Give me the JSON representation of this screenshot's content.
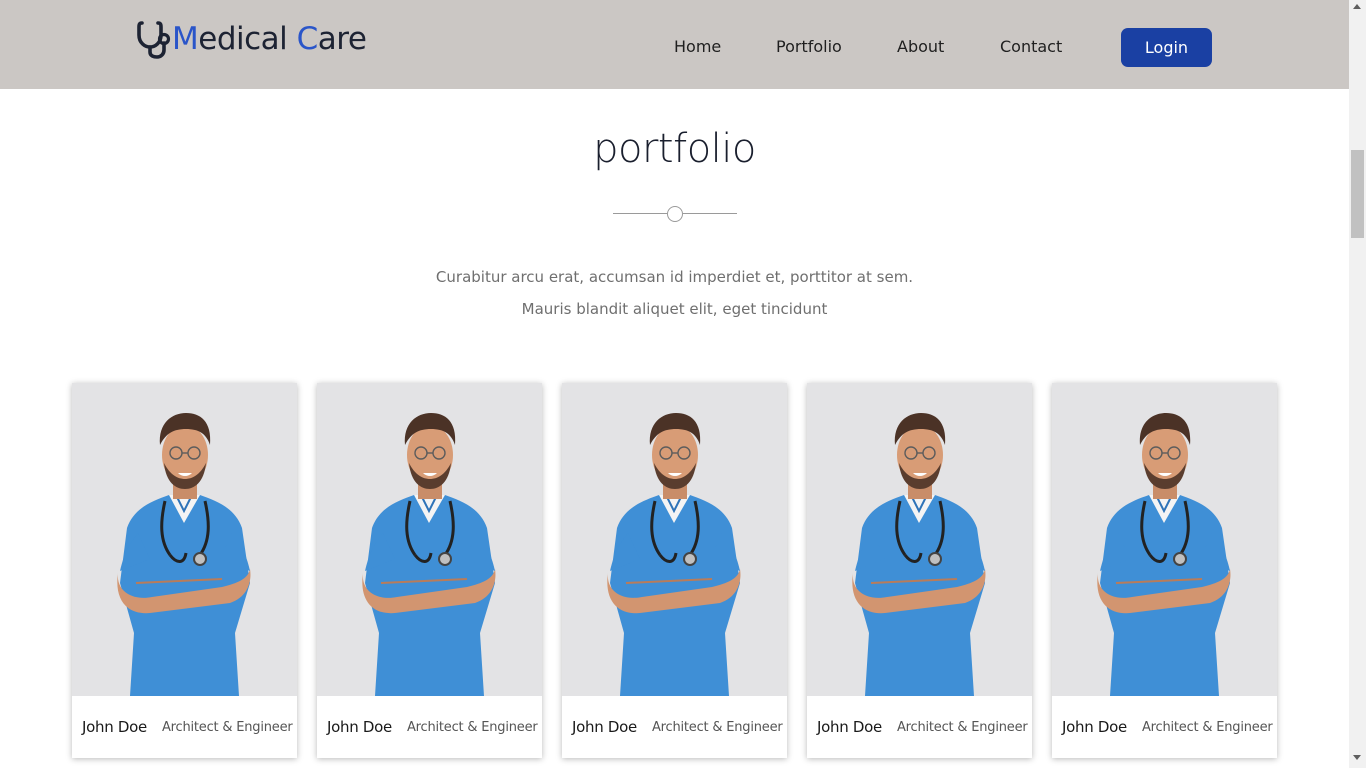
{
  "header": {
    "logo": {
      "icon": "stethoscope-icon",
      "word1_initial": "M",
      "word1_rest": "edical",
      "word2_initial": "C",
      "word2_rest": "are"
    },
    "nav": [
      "Home",
      "Portfolio",
      "About",
      "Contact"
    ],
    "login_label": "Login"
  },
  "section": {
    "title": "portfolio",
    "desc_line1": "Curabitur arcu erat, accumsan id imperdiet et, porttitor at sem.",
    "desc_line2": "Mauris blandit aliquet elit, eget tincidunt"
  },
  "cards": [
    {
      "name": "John Doe",
      "role": "Architect & Engineer",
      "image": "doctor-photo"
    },
    {
      "name": "John Doe",
      "role": "Architect & Engineer",
      "image": "doctor-photo"
    },
    {
      "name": "John Doe",
      "role": "Architect & Engineer",
      "image": "doctor-photo"
    },
    {
      "name": "John Doe",
      "role": "Architect & Engineer",
      "image": "doctor-photo"
    },
    {
      "name": "John Doe",
      "role": "Architect & Engineer",
      "image": "doctor-photo"
    }
  ],
  "colors": {
    "header_bg": "#cbc7c4",
    "brand_blue": "#2a55c9",
    "login_bg": "#1a40a3",
    "scrubs": "#3f8fd6"
  }
}
